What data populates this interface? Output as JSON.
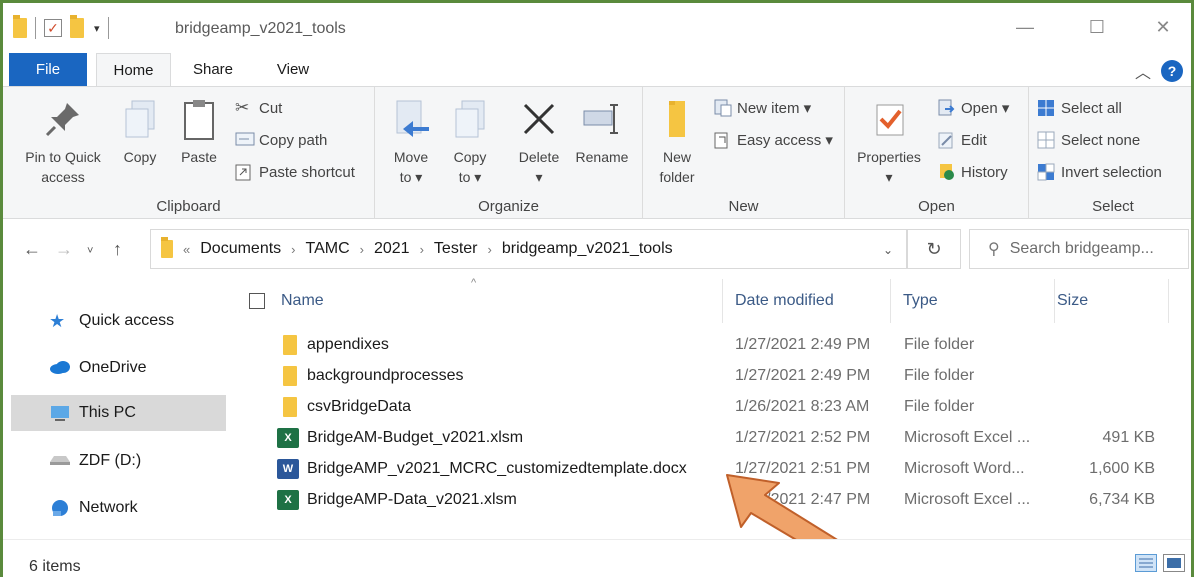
{
  "window": {
    "title": "bridgeamp_v2021_tools",
    "minimize": "—",
    "maximize": "☐",
    "close": "✕"
  },
  "ribbon_tabs": [
    "File",
    "Home",
    "Share",
    "View"
  ],
  "ribbon": {
    "clipboard": {
      "label": "Clipboard",
      "pin_line1": "Pin to Quick",
      "pin_line2": "access",
      "copy": "Copy",
      "paste": "Paste",
      "cut": "Cut",
      "copy_path": "Copy path",
      "paste_shortcut": "Paste shortcut"
    },
    "organize": {
      "label": "Organize",
      "move_line1": "Move",
      "move_line2": "to ▾",
      "copy_line1": "Copy",
      "copy_line2": "to ▾",
      "delete": "Delete",
      "delete_sub": "▾",
      "rename": "Rename"
    },
    "new": {
      "label": "New",
      "folder_line1": "New",
      "folder_line2": "folder",
      "new_item": "New item ▾",
      "easy_access": "Easy access ▾"
    },
    "open": {
      "label": "Open",
      "properties": "Properties",
      "properties_sub": "▾",
      "open": "Open ▾",
      "edit": "Edit",
      "history": "History"
    },
    "select": {
      "label": "Select",
      "select_all": "Select all",
      "select_none": "Select none",
      "invert": "Invert selection"
    }
  },
  "address": {
    "overflow": "«",
    "crumbs": [
      "Documents",
      "TAMC",
      "2021",
      "Tester",
      "bridgeamp_v2021_tools"
    ],
    "search_placeholder": "Search bridgeamp..."
  },
  "nav_pane": [
    {
      "label": "Quick access",
      "icon": "star-icon"
    },
    {
      "label": "OneDrive",
      "icon": "cloud-icon"
    },
    {
      "label": "This PC",
      "icon": "computer-icon"
    },
    {
      "label": "ZDF (D:)",
      "icon": "drive-icon"
    },
    {
      "label": "Network",
      "icon": "network-icon"
    }
  ],
  "columns": {
    "name": "Name",
    "date": "Date modified",
    "type": "Type",
    "size": "Size"
  },
  "files": [
    {
      "name": "appendixes",
      "date": "1/27/2021 2:49 PM",
      "type": "File folder",
      "size": "",
      "kind": "folder"
    },
    {
      "name": "backgroundprocesses",
      "date": "1/27/2021 2:49 PM",
      "type": "File folder",
      "size": "",
      "kind": "folder"
    },
    {
      "name": "csvBridgeData",
      "date": "1/26/2021 8:23 AM",
      "type": "File folder",
      "size": "",
      "kind": "folder"
    },
    {
      "name": "BridgeAM-Budget_v2021.xlsm",
      "date": "1/27/2021 2:52 PM",
      "type": "Microsoft Excel ...",
      "size": "491 KB",
      "kind": "excel"
    },
    {
      "name": "BridgeAMP_v2021_MCRC_customizedtemplate.docx",
      "date": "1/27/2021 2:51 PM",
      "type": "Microsoft Word...",
      "size": "1,600 KB",
      "kind": "word"
    },
    {
      "name": "BridgeAMP-Data_v2021.xlsm",
      "date": "1/27/2021 2:47 PM",
      "type": "Microsoft Excel ...",
      "size": "6,734 KB",
      "kind": "excel"
    }
  ],
  "status": {
    "items": "6 items"
  },
  "colors": {
    "accent": "#1a66c1",
    "frame": "#5a8a3c",
    "arrow": "#f0a36a",
    "arrow_stroke": "#c0602a"
  }
}
